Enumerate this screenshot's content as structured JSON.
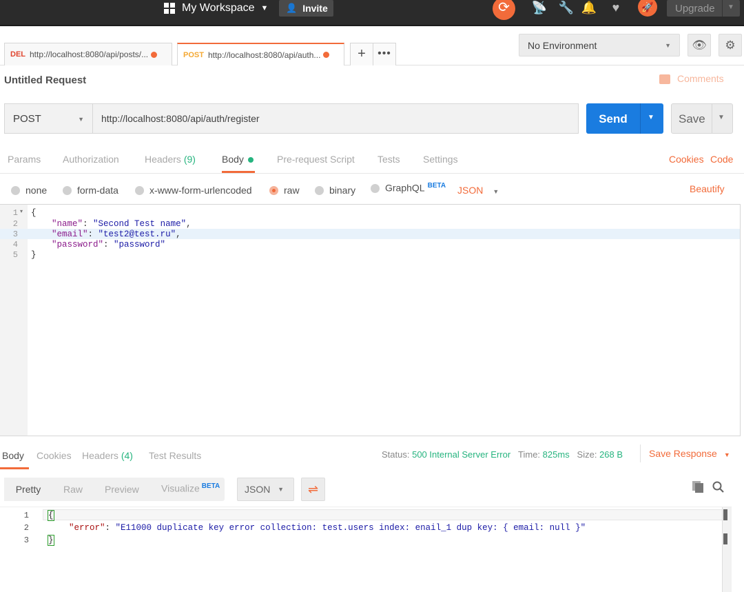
{
  "topbar": {
    "workspace_label": "My Workspace",
    "invite_label": "Invite",
    "upgrade_label": "Upgrade"
  },
  "tabs": [
    {
      "method": "DEL",
      "url": "http://localhost:8080/api/posts/...",
      "method_color": "#e0462f"
    },
    {
      "method": "POST",
      "url": "http://localhost:8080/api/auth...",
      "method_color": "#f4a833"
    }
  ],
  "environment": {
    "selected": "No Environment"
  },
  "request": {
    "name": "Untitled Request",
    "comments_label": "Comments",
    "method": "POST",
    "url": "http://localhost:8080/api/auth/register",
    "send_label": "Send",
    "save_label": "Save"
  },
  "request_tabs": {
    "params": "Params",
    "authorization": "Authorization",
    "headers": "Headers",
    "headers_count": "(9)",
    "body": "Body",
    "prerequest": "Pre-request Script",
    "tests": "Tests",
    "settings": "Settings",
    "cookies": "Cookies",
    "code": "Code"
  },
  "body_types": {
    "none": "none",
    "form_data": "form-data",
    "urlencoded": "x-www-form-urlencoded",
    "raw": "raw",
    "binary": "binary",
    "graphql": "GraphQL",
    "beta": "BETA",
    "format": "JSON",
    "beautify": "Beautify",
    "selected": "raw"
  },
  "editor": {
    "line_numbers": [
      "1",
      "2",
      "3",
      "4",
      "5"
    ],
    "lines": [
      {
        "open": "{"
      },
      {
        "key": "\"name\"",
        "value": "\"Second Test name\""
      },
      {
        "key": "\"email\"",
        "value": "\"test2@test.ru\""
      },
      {
        "key": "\"password\"",
        "value": "\"password\""
      },
      {
        "close": "}"
      }
    ]
  },
  "response": {
    "tabs": {
      "body": "Body",
      "cookies": "Cookies",
      "headers": "Headers",
      "headers_count": "(4)",
      "tests": "Test Results"
    },
    "status_label": "Status:",
    "status": "500 Internal Server Error",
    "time_label": "Time:",
    "time": "825ms",
    "size_label": "Size:",
    "size": "268 B",
    "save_response": "Save Response",
    "views": {
      "pretty": "Pretty",
      "raw": "Raw",
      "preview": "Preview",
      "visualize": "Visualize",
      "beta": "BETA"
    },
    "format": "JSON",
    "line_numbers": [
      "1",
      "2",
      "3"
    ],
    "error_key": "\"error\"",
    "error_value": "\"E11000 duplicate key error collection: test.users index: enail_1 dup key: { email: null }\""
  },
  "colors": {
    "accent": "#f26b3a",
    "send_blue": "#1a7ce0",
    "success_green": "#26b47f"
  }
}
